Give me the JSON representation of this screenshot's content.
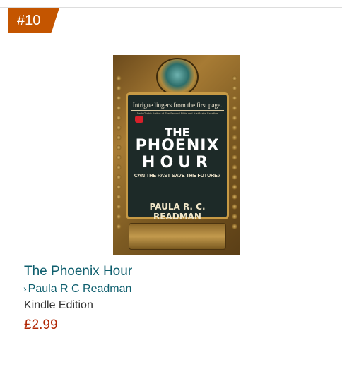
{
  "rank_badge": "#10",
  "cover": {
    "tagline": "Intrigue lingers from the first page.",
    "subtagline": "Dark Gothic Author of The Second Bible and Just Make Sacrifice",
    "title_line1": "THE",
    "title_line2": "PHOENIX",
    "title_line3": "HOUR",
    "strapline": "CAN THE PAST SAVE THE FUTURE?",
    "author": "PAULA R. C. READMAN"
  },
  "product": {
    "title": "The Phoenix Hour",
    "author_chevron": "›",
    "author": "Paula R C Readman",
    "edition": "Kindle Edition",
    "price": "£2.99"
  },
  "colors": {
    "badge": "#c45500",
    "link": "#0f5f6e",
    "price": "#b12704"
  }
}
